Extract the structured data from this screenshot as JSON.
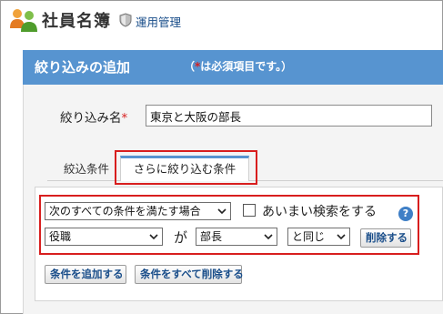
{
  "header": {
    "app_title": "社員名簿",
    "admin_link": "運用管理",
    "logo_icon": "people-icon",
    "admin_icon": "shield-icon"
  },
  "panel": {
    "title": "絞り込みの追加",
    "required_note_open": "（",
    "required_note_mark": "*",
    "required_note_text": "は必須項目です。）",
    "header_color": "#5794d0"
  },
  "form": {
    "name_label": "絞り込み名",
    "name_required_mark": "*",
    "name_value": "東京と大阪の部長"
  },
  "tabs": [
    {
      "label": "絞込条件",
      "active": false
    },
    {
      "label": "さらに絞り込む条件",
      "active": true
    }
  ],
  "conditions": {
    "match_mode": "次のすべての条件を満たす場合",
    "fuzzy_checkbox_label": "あいまい検索をする",
    "fuzzy_checked": false,
    "help_icon": "question-icon",
    "rows": [
      {
        "field": "役職",
        "connector": "が",
        "value": "部長",
        "operator": "と同じ",
        "delete_label": "削除する"
      }
    ]
  },
  "actions": {
    "add_condition": "条件を追加する",
    "delete_all": "条件をすべて削除する"
  },
  "colors": {
    "highlight_red": "#d81e1e",
    "link_blue": "#1a4e8a"
  }
}
